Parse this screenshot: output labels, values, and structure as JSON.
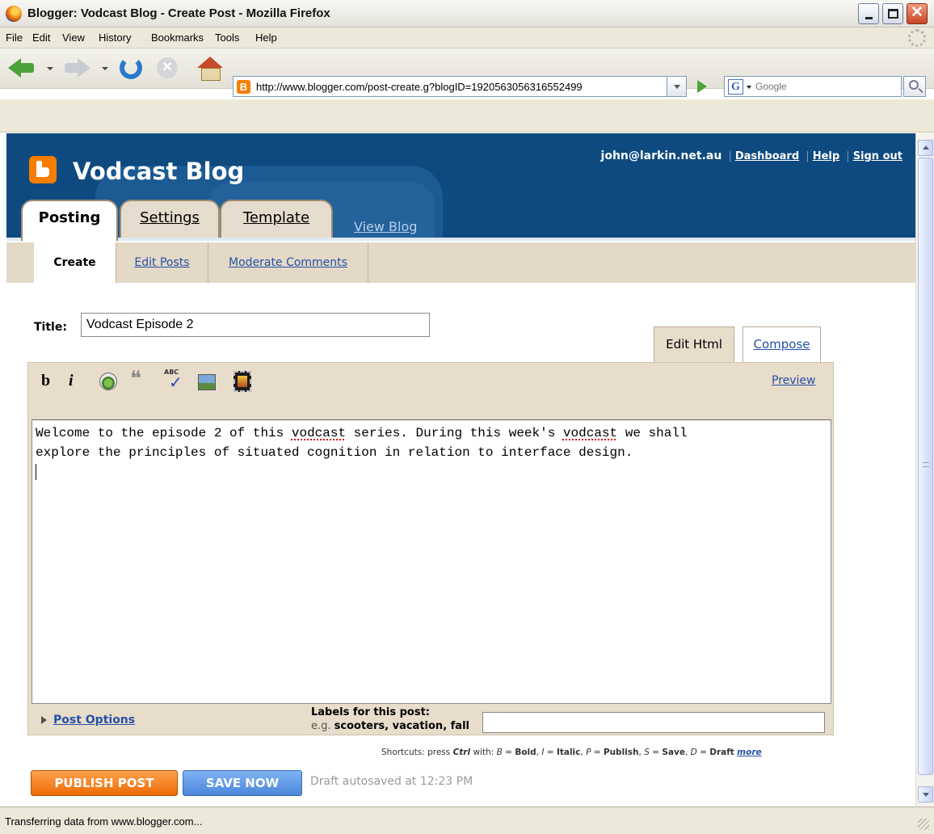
{
  "window": {
    "title": "Blogger: Vodcast Blog - Create Post - Mozilla Firefox"
  },
  "menu": [
    "File",
    "Edit",
    "View",
    "History",
    "Bookmarks",
    "Tools",
    "Help"
  ],
  "navbar": {
    "url": "http://www.blogger.com/post-create.g?blogID=1920563056316552499",
    "search_placeholder": "Google",
    "search_engine_icon": "G"
  },
  "blog": {
    "name": "Vodcast Blog",
    "user_email": "john@larkin.net.au",
    "links": [
      "Dashboard",
      "Help",
      "Sign out"
    ]
  },
  "tabs": [
    "Posting",
    "Settings",
    "Template",
    "View Blog"
  ],
  "subtabs": [
    "Create",
    "Edit Posts",
    "Moderate Comments"
  ],
  "post": {
    "title_label": "Title:",
    "title_value": "Vodcast Episode 2",
    "editor_tabs": [
      "Edit Html",
      "Compose"
    ],
    "preview_label": "Preview",
    "body_parts": [
      "Welcome to the episode 2 of this ",
      "vodcast",
      " series. During this week's ",
      "vodcast",
      " we shall\nexplore the principles of situated cognition in relation to interface design."
    ],
    "toolbar": [
      "b",
      "i"
    ]
  },
  "footer": {
    "post_options": "Post Options",
    "labels_title": "Labels for this post:",
    "labels_eg_prefix": "e.g.",
    "labels_eg_values": "scooters, vacation, fall",
    "labels_value": ""
  },
  "shortcuts": {
    "prefix": "Shortcuts: press",
    "ctrl": "Ctrl",
    "with": "with:",
    "items": [
      {
        "key": "B",
        "label": "Bold"
      },
      {
        "key": "I",
        "label": "Italic"
      },
      {
        "key": "P",
        "label": "Publish"
      },
      {
        "key": "S",
        "label": "Save"
      },
      {
        "key": "D",
        "label": "Draft"
      }
    ],
    "more": "more"
  },
  "actions": {
    "publish": "PUBLISH POST",
    "save": "SAVE NOW",
    "autosave": "Draft autosaved at 12:23 PM"
  },
  "status": {
    "text": "Transferring data from www.blogger.com..."
  },
  "colors": {
    "header_blue": "#0e4a80",
    "publish_orange": "#ec6a07",
    "save_blue": "#4a86dc",
    "link_blue": "#2452a6"
  }
}
